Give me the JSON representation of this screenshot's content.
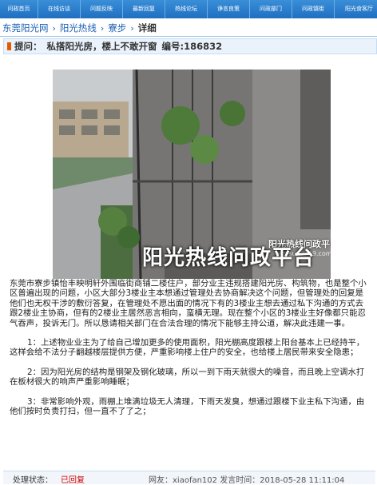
{
  "nav": {
    "items": [
      "问政首页",
      "在线访谈",
      "问题反映",
      "最新回复",
      "热线论坛",
      "诤言良策",
      "问政部门",
      "问政镇街",
      "阳光食客厅"
    ]
  },
  "breadcrumb": {
    "items": [
      "东莞阳光网",
      "阳光热线",
      "寮步"
    ],
    "current": "详细"
  },
  "title": {
    "label": "提问：",
    "text": "私搭阳光房，楼上不敢开窗",
    "id_label": "编号:186832"
  },
  "photo": {
    "watermark_small": "阳光热线问政平台",
    "watermark_url": "wz.sun0769.com",
    "watermark_large": "阳光热线问政平台"
  },
  "content": {
    "intro": "东莞市寮步镇怡丰映明轩外围临街商铺二楼住户，部分业主违规搭建阳光房、构筑物，也是整个小区普遍出现的问题，小区大部分3楼业主本想通过管理处去协商解决这个问题，但管理处的回复是他们也无权干涉的敷衍答复，在管理处不愿出面的情况下有的3楼业主想去通过私下沟通的方式去跟2楼业主协商，但有的2楼业主居然恶言相向，蛮横无理。现在整个小区的3楼业主好像都只能忍气吞声，投诉无门。所以恳请相关部门在合法合理的情况下能够主持公道，解决此违建一事。",
    "item1": "1：上述物业业主为了给自己增加更多的使用面积，阳光棚高度跟楼上阳台基本上已经持平，这样会给不法分子翻越楼层提供方便，严重影响楼上住户的安全，也给楼上居民带来安全隐患；",
    "item2": "2：因为阳光房的结构是钢架及钢化玻璃，所以一到下雨天就很大的噪音，而且晚上空调水打在板材很大的响声严重影响睡眠；",
    "item3": "3：非常影响外观，雨棚上堆满垃圾无人清理，下雨天发臭，想通过跟楼下业主私下沟通，由他们按时负责打扫，但一直不了了之；"
  },
  "footer": {
    "status_label": "处理状态：",
    "status_value": "已回复",
    "meta": "网友：xiaofan102 发言时间：2018-05-28 11:11:04"
  },
  "colors": {
    "nav_bg": "#1f6fc0",
    "link": "#1a5fb4",
    "accent": "#e55a00",
    "status": "#d40000"
  }
}
